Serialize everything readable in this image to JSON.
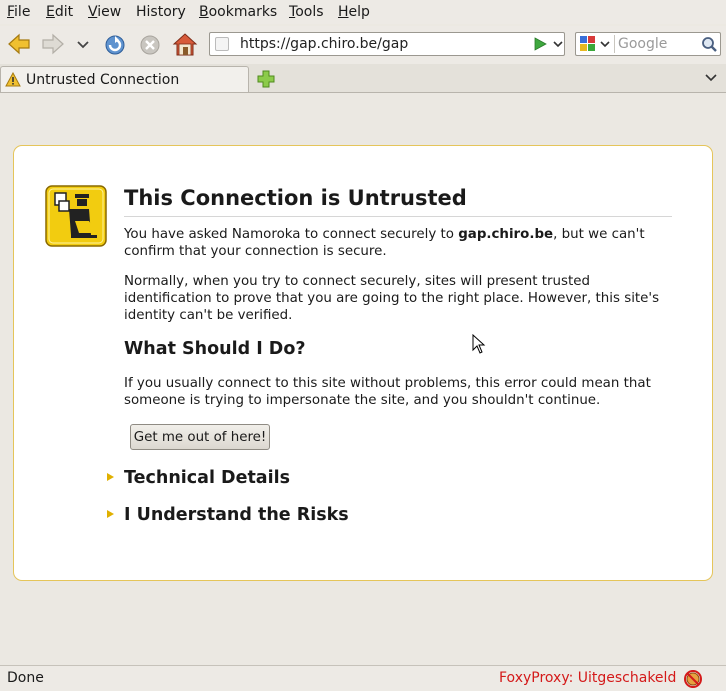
{
  "menu": {
    "items": [
      {
        "first": "F",
        "rest": "ile"
      },
      {
        "first": "E",
        "rest": "dit"
      },
      {
        "first": "V",
        "rest": "iew"
      },
      {
        "first": "",
        "rest": "History"
      },
      {
        "first": "B",
        "rest": "ookmarks"
      },
      {
        "first": "T",
        "rest": "ools"
      },
      {
        "first": "H",
        "rest": "elp"
      }
    ]
  },
  "navbar": {
    "url": "https://gap.chiro.be/gap",
    "search_placeholder": "Google",
    "icons": [
      "back-arrow-icon",
      "forward-arrow-icon",
      "history-dropdown-icon",
      "reload-icon",
      "stop-icon",
      "home-icon",
      "go-arrow-icon",
      "search-magnifier-icon"
    ]
  },
  "tabs": [
    {
      "label": "Untrusted Connection",
      "icon": "warning-icon"
    }
  ],
  "page": {
    "title": "This Connection is Untrusted",
    "intro_prefix": "You have asked Namoroka to connect securely to ",
    "host": "gap.chiro.be",
    "intro_suffix": ", but we can't confirm that your connection is secure.",
    "para2": "Normally, when you try to connect securely, sites will present trusted identification to prove that you are going to the right place. However, this site's identity can't be verified.",
    "what_heading": "What Should I Do?",
    "para3": "If you usually connect to this site without problems, this error could mean that someone is trying to impersonate the site, and you shouldn't continue.",
    "escape_button": "Get me out of here!",
    "technical_details": "Technical Details",
    "understand_risks": "I Understand the Risks"
  },
  "status": {
    "text": "Done",
    "foxyproxy": "FoxyProxy: Uitgeschakeld"
  },
  "colors": {
    "accent_border": "#e5c55a",
    "expander_triangle": "#e0b000",
    "foxyproxy_text": "#d41a1a"
  }
}
